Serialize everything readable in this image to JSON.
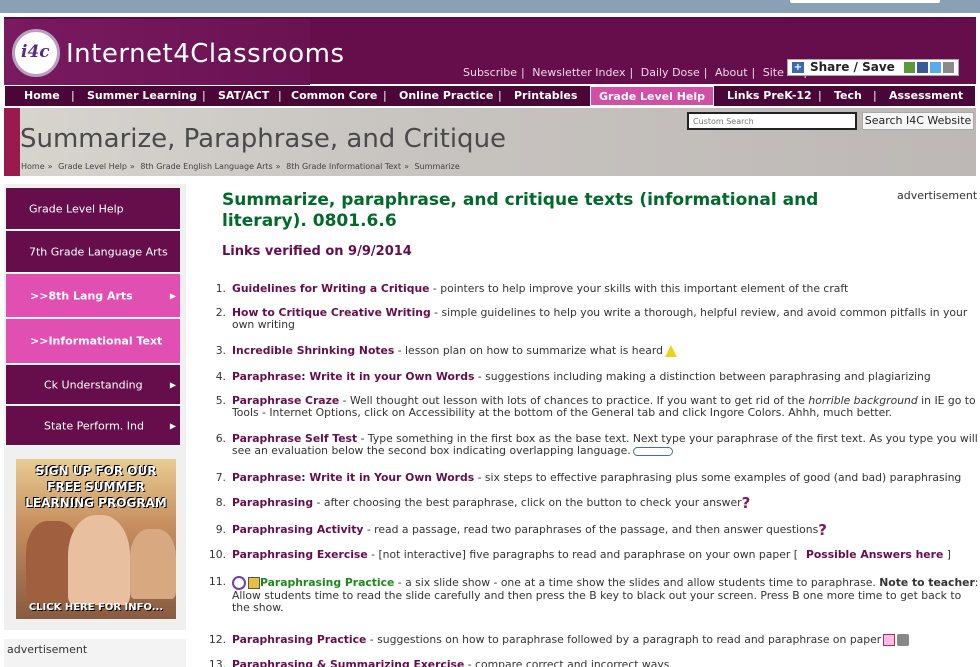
{
  "site": {
    "logo_mark": "i4c",
    "logo_text": "Internet4Classrooms",
    "top_links": [
      "Subscribe",
      "Newsletter Index",
      "Daily Dose",
      "About",
      "Site Map"
    ],
    "share_label": "Share / Save"
  },
  "nav": {
    "items": [
      "Home",
      "Summer Learning",
      "SAT/ACT",
      "Common Core",
      "Online Practice",
      "Printables",
      "Grade Level Help",
      "Links PreK-12",
      "Tech",
      "Assessment"
    ],
    "active": "Grade Level Help"
  },
  "banner": {
    "title": "Summarize, Paraphrase, and Critique",
    "breadcrumb": [
      "Home",
      "Grade Level Help",
      "8th Grade English Language Arts",
      "8th Grade Informational Text",
      "Summarize"
    ],
    "search_placeholder": "Custom Search",
    "search_button": "Search I4C Website"
  },
  "sidebar": {
    "items": [
      {
        "label": "Grade Level Help",
        "style": "dark"
      },
      {
        "label": "7th Grade Language Arts",
        "style": "dark"
      },
      {
        "label": "8th Lang Arts",
        "style": "pink"
      },
      {
        "label": "Informational Text",
        "style": "pink"
      },
      {
        "label": "Ck Understanding",
        "style": "dark"
      },
      {
        "label": "State Perform. Ind",
        "style": "dark"
      }
    ],
    "promo_line1": "SIGN UP FOR OUR",
    "promo_line2": "FREE SUMMER",
    "promo_line3": "LEARNING PROGRAM",
    "promo_cta": "CLICK HERE FOR INFO...",
    "ad_label": "advertisement"
  },
  "main": {
    "ad_label": "advertisement",
    "title": "Summarize, paraphrase, and critique texts (informational and literary). 0801.6.6",
    "verified": "Links verified on 9/9/2014"
  },
  "resources": [
    {
      "num": "1.",
      "link": "Guidelines for Writing a Critique",
      "desc": " - pointers to help improve your skills with this  important element of the craft"
    },
    {
      "num": "2.",
      "link": "How to Critique Creative Writing",
      "desc": " - simple guidelines to help you write a thorough, helpful review, and avoid common pitfalls in your own writing"
    },
    {
      "num": "3.",
      "link": "Incredible Shrinking Notes",
      "desc": " - lesson plan on how to summarize what is heard"
    },
    {
      "num": "4.",
      "link": "Paraphrase: Write it in your Own Words",
      "desc": " - suggestions including making a distinction between paraphrasing and plagiarizing"
    },
    {
      "num": "5.",
      "link": "Paraphrase Craze",
      "desc": " - Well thought out lesson with lots of chances to practice. If you want to get rid of the ",
      "desc_em": "horrible background",
      "desc2": " in IE go to Tools - Internet Options, click on Accessibility at the bottom of the General tab and click Ingore Colors. Ahhh, much better."
    },
    {
      "num": "6.",
      "link": "Paraphrase Self Test",
      "desc": " - Type something in the first box as the base text. Next type your paraphrase of the first text. As you type you will see an evaluation below the second box indicating overlapping language."
    },
    {
      "num": "7.",
      "link": "Paraphrase: Write it in Your Own Words",
      "desc": " - six steps to effective paraphrasing plus some examples of good (and bad) paraphrasing"
    },
    {
      "num": "8.",
      "link": "Paraphrasing",
      "desc": " - after choosing the best paraphrase, click on the button to check your answer"
    },
    {
      "num": "9.",
      "link": "Paraphrasing  Activity",
      "desc": " - read a passage, read two paraphrases of the passage, and then answer questions"
    },
    {
      "num": "10.",
      "link": "Paraphrasing  Exercise",
      "desc": " - [not interactive] five paragraphs to read and paraphrase on your own paper [",
      "extra_link": "Possible Answers here",
      "desc2": " ]"
    },
    {
      "num": "11.",
      "link": "Paraphrasing  Practice",
      "desc": " - a six slide show - one at a time show the slides and allow students time to paraphrase. ",
      "bold2": "Note to teacher",
      "desc2": ": Allow students time to read the slide carefully and then press the B key to black out your screen. Press B one more time to get back to the show."
    },
    {
      "num": "12.",
      "link": "Paraphrasing  Practice",
      "desc": " - suggestions on how to paraphrase followed by a paragraph to read and paraphrase on paper"
    },
    {
      "num": "13.",
      "link": "Paraphrasing  & Summarizing Exercise",
      "desc": " - compare correct and incorrect ways"
    }
  ]
}
